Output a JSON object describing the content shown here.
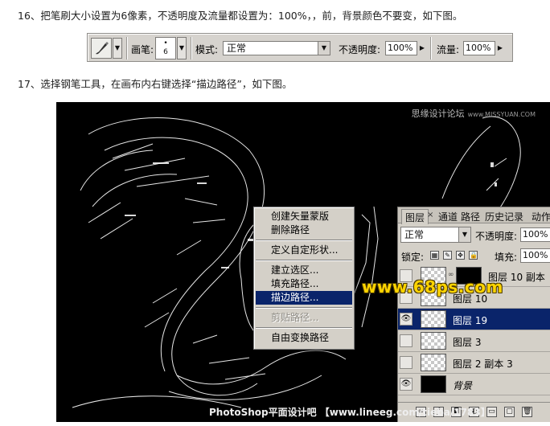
{
  "steps": {
    "step16": "16、把笔刷大小设置为6像素，不透明度及流量都设置为：100%，，前，背景颜色不要变，如下图。",
    "step17": "17、选择钢笔工具，在画布内右键选择“描边路径”，如下图。"
  },
  "options_bar": {
    "brush_label": "画笔:",
    "brush_size": "6",
    "mode_label": "模式:",
    "mode_value": "正常",
    "opacity_label": "不透明度:",
    "opacity_value": "100%",
    "flow_label": "流量:",
    "flow_value": "100%"
  },
  "context_menu": {
    "groups": [
      [
        "创建矢量蒙版",
        "删除路径"
      ],
      [
        "定义自定形状..."
      ],
      [
        "建立选区...",
        "填充路径...",
        "描边路径..."
      ],
      [
        "剪贴路径..."
      ],
      [
        "自由变换路径"
      ]
    ],
    "highlighted": "描边路径...",
    "disabled": "剪贴路径..."
  },
  "layers_panel": {
    "tabs": [
      "图层",
      "通道",
      "路径",
      "历史记录",
      "动作"
    ],
    "blend_mode": "正常",
    "opacity_label": "不透明度:",
    "opacity_value": "100%",
    "lock_label": "锁定:",
    "fill_label": "填充:",
    "fill_value": "100%",
    "layers": [
      {
        "name": "图层 10 副本",
        "visible": false,
        "selected": false
      },
      {
        "name": "图层 10",
        "visible": false,
        "selected": false
      },
      {
        "name": "图层 19",
        "visible": true,
        "selected": true
      },
      {
        "name": "图层 3",
        "visible": false,
        "selected": false
      },
      {
        "name": "图层 2 副本 3",
        "visible": false,
        "selected": false
      },
      {
        "name": "背景",
        "visible": true,
        "selected": false
      }
    ],
    "bottom_icons": [
      "link-icon",
      "fx-icon",
      "mask-icon",
      "adjustment-icon",
      "group-icon",
      "new-layer-icon",
      "trash-icon"
    ]
  },
  "watermarks": {
    "top_right": "思缘设计论坛",
    "top_right_url": "www.MISSYUAN.COM",
    "center": "www.68ps.com",
    "bottom": "PhotoShop平面设计吧 【www.lineeg.com/tieba/1783】"
  },
  "colors": {
    "menu_highlight": "#0a246a",
    "panel_bg": "#d4d0c8",
    "watermark_yellow": "#ffd400"
  }
}
